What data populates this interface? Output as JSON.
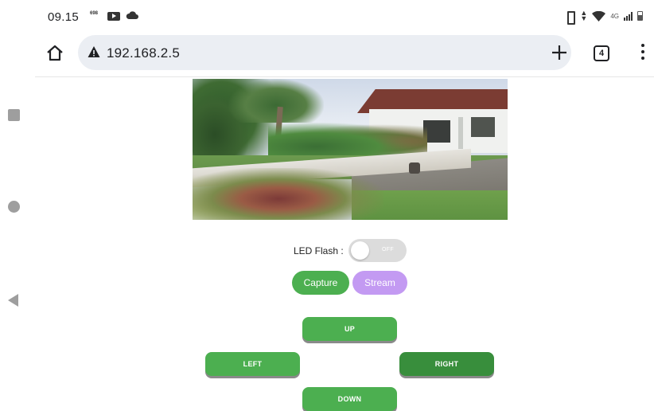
{
  "status_bar": {
    "time": "09.15",
    "data_badge": "698",
    "icons": [
      "data-speed-badge",
      "youtube-icon",
      "cloud-icon",
      "vibrate-icon",
      "data-arrows-icon",
      "wifi-icon",
      "signal-icon",
      "battery-icon"
    ],
    "signal_label": "4G"
  },
  "browser": {
    "url": "192.168.2.5",
    "tab_count": "4",
    "icons": [
      "home-icon",
      "warning-icon",
      "plus-icon",
      "tabs-icon",
      "menu-icon"
    ]
  },
  "system_nav": {
    "icons": [
      "recents-square-icon",
      "home-circle-icon",
      "back-triangle-icon"
    ]
  },
  "controls": {
    "led_label": "LED Flash :",
    "led_state": "OFF",
    "capture_label": "Capture",
    "stream_label": "Stream",
    "up_label": "UP",
    "left_label": "LEFT",
    "right_label": "RIGHT",
    "down_label": "DOWN"
  },
  "colors": {
    "green": "#4caf50",
    "green_dark": "#388e3c",
    "purple": "#c39af2",
    "toggle_off": "#dcdcdc",
    "url_bar": "#ebeef3"
  }
}
